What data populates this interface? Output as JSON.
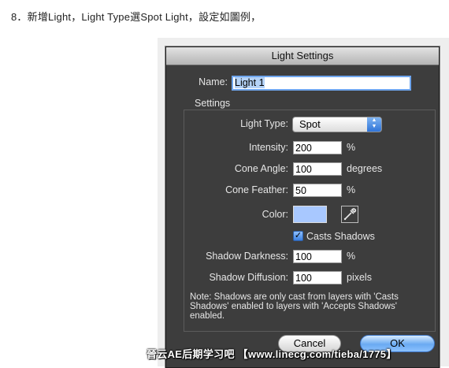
{
  "caption": "8．新增Light，Light Type選Spot Light，設定如圖例，",
  "dialog": {
    "title": "Light Settings",
    "name_label": "Name:",
    "name_value": "Light 1",
    "settings_label": "Settings",
    "light_type_label": "Light Type:",
    "light_type_value": "Spot",
    "intensity_label": "Intensity:",
    "intensity_value": "200",
    "intensity_unit": "%",
    "cone_angle_label": "Cone Angle:",
    "cone_angle_value": "100",
    "cone_angle_unit": "degrees",
    "cone_feather_label": "Cone Feather:",
    "cone_feather_value": "50",
    "cone_feather_unit": "%",
    "color_label": "Color:",
    "color_value": "#a8c8ff",
    "casts_shadows_label": "Casts Shadows",
    "casts_shadows_checked": true,
    "shadow_darkness_label": "Shadow Darkness:",
    "shadow_darkness_value": "100",
    "shadow_darkness_unit": "%",
    "shadow_diffusion_label": "Shadow Diffusion:",
    "shadow_diffusion_value": "100",
    "shadow_diffusion_unit": "pixels",
    "note": "Note: Shadows are only cast from layers with 'Casts Shadows' enabled to layers with 'Accepts Shadows' enabled.",
    "cancel_label": "Cancel",
    "ok_label": "OK"
  },
  "watermark": "晉云AE后期学习吧 【www.linecg.com/tieba/1775】"
}
